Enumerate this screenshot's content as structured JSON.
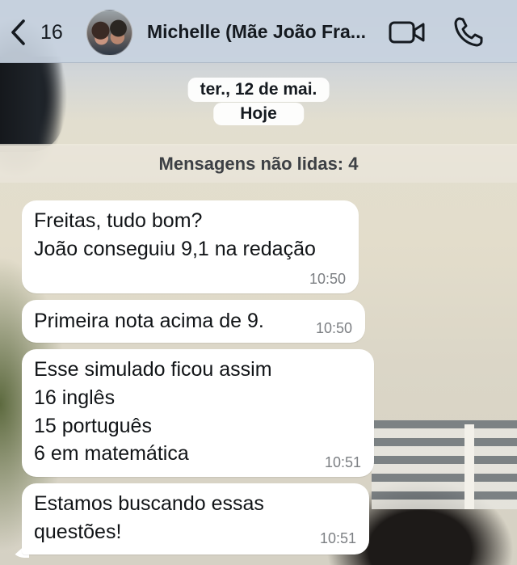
{
  "header": {
    "back_count": "16",
    "contact_name": "Michelle (Mãe João Fra...",
    "icons": {
      "back": "chevron-left-icon",
      "video": "video-camera-icon",
      "call": "phone-icon"
    },
    "accent_color": "#151a20"
  },
  "date_chips": {
    "date": "ter., 12 de mai.",
    "today": "Hoje"
  },
  "unread_banner": "Mensagens não lidas: 4",
  "messages": [
    {
      "lines": [
        "Freitas, tudo bom?",
        "João conseguiu 9,1 na redação"
      ],
      "time": "10:50"
    },
    {
      "lines": [
        "Primeira nota acima de 9."
      ],
      "time": "10:50"
    },
    {
      "lines": [
        "Esse simulado ficou assim",
        "16 inglês",
        "15 português",
        "6 em matemática"
      ],
      "time": "10:51"
    },
    {
      "lines": [
        "Estamos buscando essas",
        "questões!"
      ],
      "time": "10:51"
    }
  ]
}
